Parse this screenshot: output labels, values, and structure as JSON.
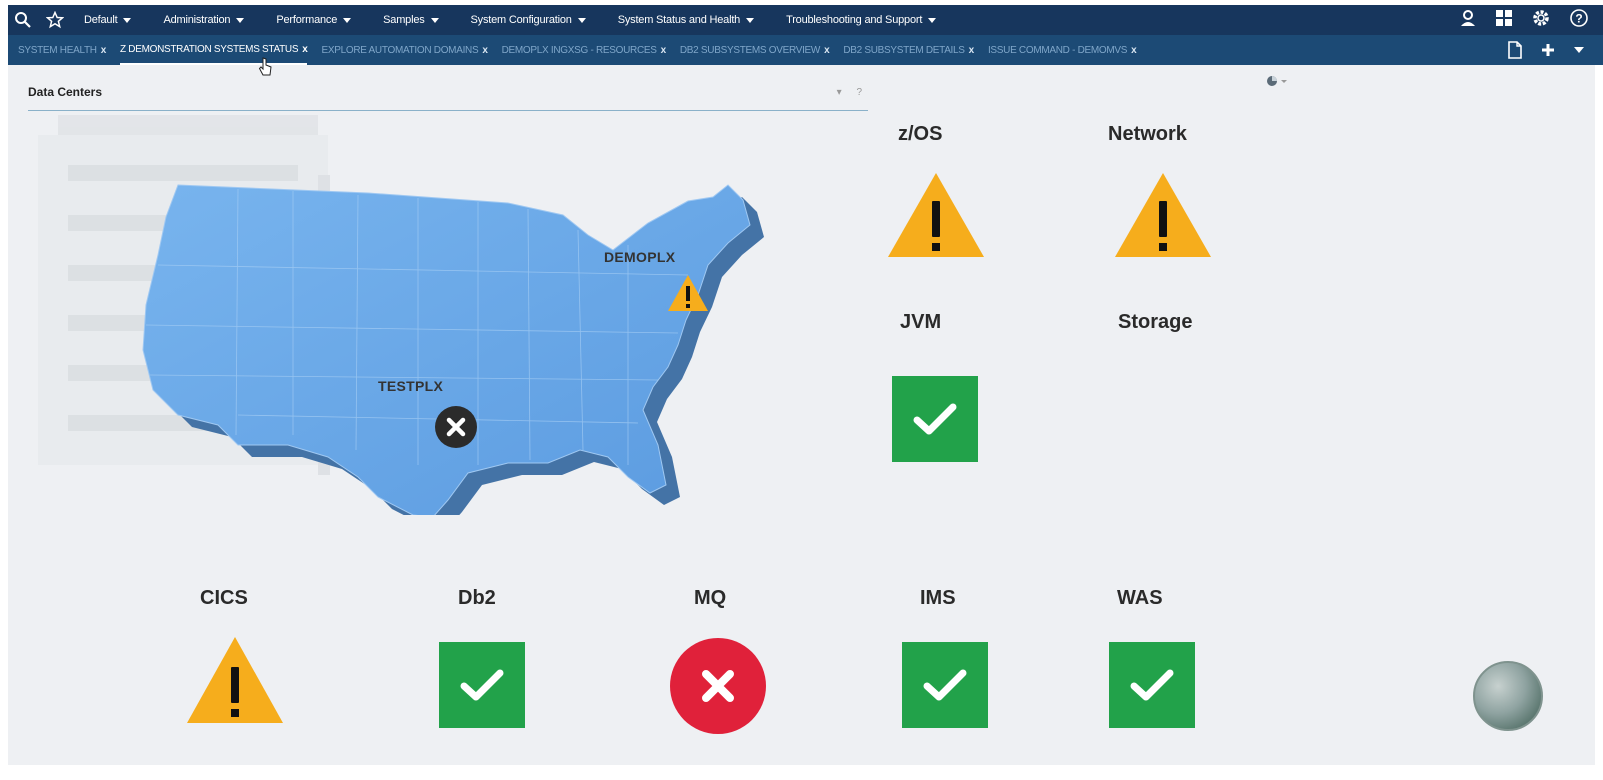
{
  "menubar": {
    "items": [
      {
        "label": "Default"
      },
      {
        "label": "Administration"
      },
      {
        "label": "Performance"
      },
      {
        "label": "Samples"
      },
      {
        "label": "System Configuration"
      },
      {
        "label": "System Status and Health"
      },
      {
        "label": "Troubleshooting and Support"
      }
    ]
  },
  "tabs": [
    {
      "label": "SYSTEM HEALTH",
      "active": false
    },
    {
      "label": "Z DEMONSTRATION SYSTEMS STATUS",
      "active": true
    },
    {
      "label": "EXPLORE AUTOMATION DOMAINS",
      "active": false
    },
    {
      "label": "DEMOPLX INGXSG - RESOURCES",
      "active": false
    },
    {
      "label": "DB2 SUBSYSTEMS OVERVIEW",
      "active": false
    },
    {
      "label": "DB2 SUBSYSTEM DETAILS",
      "active": false
    },
    {
      "label": "ISSUE COMMAND - DEMOMVS",
      "active": false
    }
  ],
  "tab_close_glyph": "x",
  "panel": {
    "title": "Data Centers",
    "help": "?"
  },
  "map": {
    "sites": [
      {
        "name": "DEMOPLX",
        "status": "warning"
      },
      {
        "name": "TESTPLX",
        "status": "error"
      }
    ]
  },
  "status": {
    "zos": {
      "label": "z/OS",
      "state": "warning"
    },
    "network": {
      "label": "Network",
      "state": "warning"
    },
    "jvm": {
      "label": "JVM",
      "state": "ok"
    },
    "storage": {
      "label": "Storage",
      "state": "none"
    },
    "cics": {
      "label": "CICS",
      "state": "warning"
    },
    "db2": {
      "label": "Db2",
      "state": "ok"
    },
    "mq": {
      "label": "MQ",
      "state": "error"
    },
    "ims": {
      "label": "IMS",
      "state": "ok"
    },
    "was": {
      "label": "WAS",
      "state": "ok"
    }
  },
  "colors": {
    "menubar": "#17365d",
    "tabbar": "#1c4a75",
    "warning": "#f6ad1c",
    "ok": "#22a24a",
    "error": "#e0213a"
  },
  "icons": {
    "search": "search-icon",
    "favorites": "star-icon",
    "user": "user-icon",
    "apps": "grid-icon",
    "settings": "gear-icon",
    "help": "help-icon",
    "new_page": "document-icon",
    "add": "plus-icon",
    "more": "chevron-down-icon"
  }
}
